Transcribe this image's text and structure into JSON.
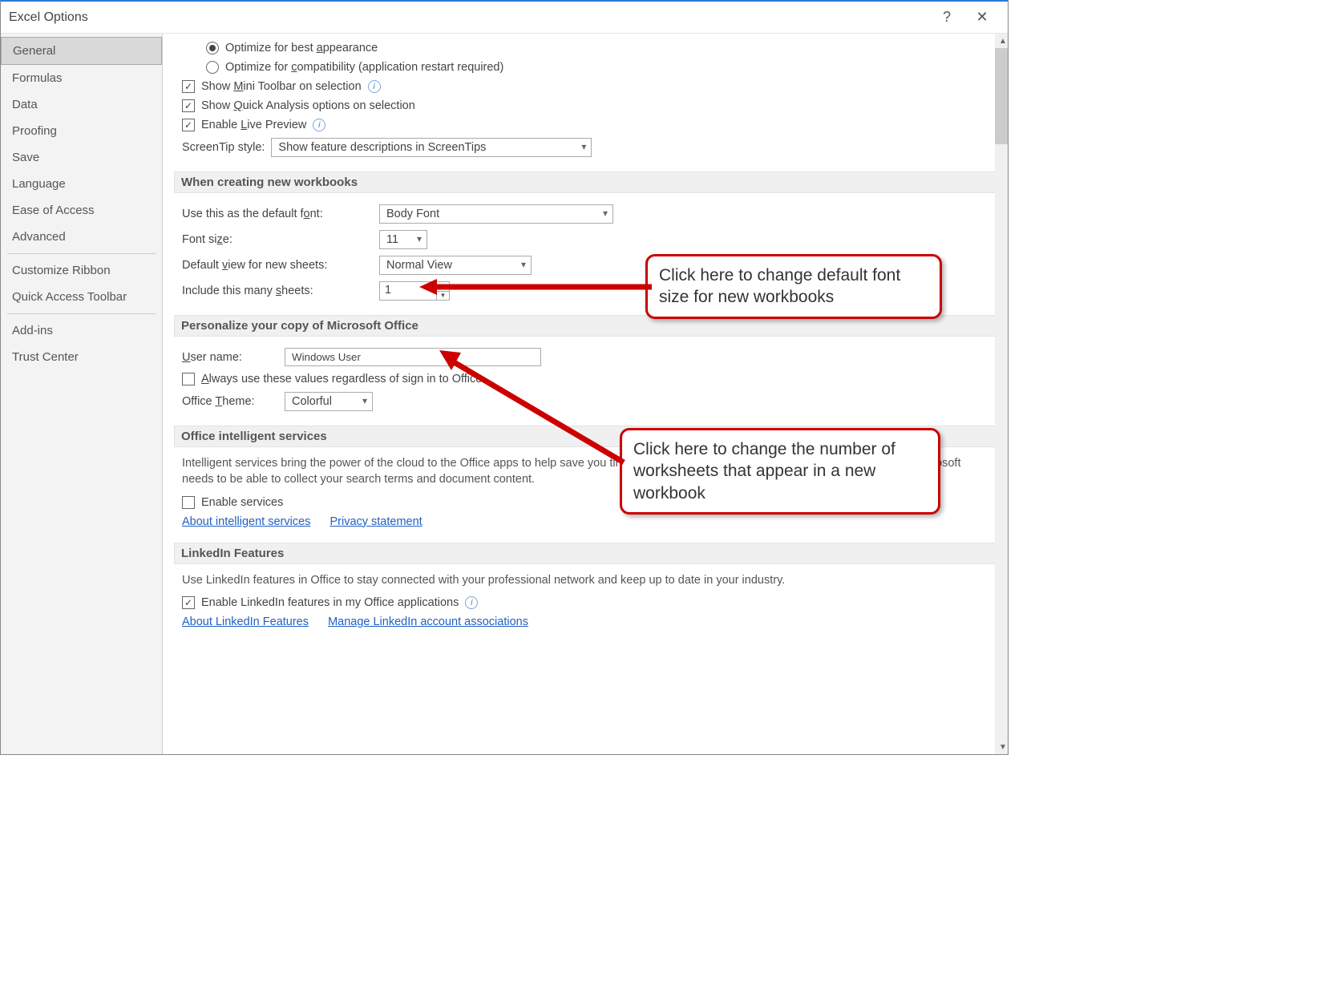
{
  "dialog": {
    "title": "Excel Options"
  },
  "sidebar": {
    "items": [
      "General",
      "Formulas",
      "Data",
      "Proofing",
      "Save",
      "Language",
      "Ease of Access",
      "Advanced",
      "Customize Ribbon",
      "Quick Access Toolbar",
      "Add-ins",
      "Trust Center"
    ],
    "selected": 0,
    "separators_after": [
      7,
      9
    ]
  },
  "ui": {
    "optimize_best": "Optimize for best appearance",
    "optimize_compat": "Optimize for compatibility (application restart required)",
    "show_mini_toolbar": "Show Mini Toolbar on selection",
    "show_quick_analysis": "Show Quick Analysis options on selection",
    "enable_live_preview": "Enable Live Preview",
    "screentip_label": "ScreenTip style:",
    "screentip_value": "Show feature descriptions in ScreenTips",
    "section_creating": "When creating new workbooks",
    "default_font_label": "Use this as the default font:",
    "default_font_value": "Body Font",
    "font_size_label": "Font size:",
    "font_size_value": "11",
    "default_view_label": "Default view for new sheets:",
    "default_view_value": "Normal View",
    "include_sheets_label": "Include this many sheets:",
    "include_sheets_value": "1",
    "section_personalize": "Personalize your copy of Microsoft Office",
    "username_label": "User name:",
    "username_value": "Windows User",
    "always_use_values": "Always use these values regardless of sign in to Office.",
    "office_theme_label": "Office Theme:",
    "office_theme_value": "Colorful",
    "section_intelligent": "Office intelligent services",
    "intelligent_desc": "Intelligent services bring the power of the cloud to the Office apps to help save you time and produce better results. To provide these services, Microsoft needs to be able to collect your search terms and document content.",
    "enable_services": "Enable services",
    "link_about_intelligent": "About intelligent services",
    "link_privacy": "Privacy statement",
    "section_linkedin": "LinkedIn Features",
    "linkedin_desc": "Use LinkedIn features in Office to stay connected with your professional network and keep up to date in your industry.",
    "enable_linkedin": "Enable LinkedIn features in my Office applications",
    "link_about_linkedin": "About LinkedIn Features",
    "link_manage_linkedin": "Manage LinkedIn account associations"
  },
  "callouts": {
    "font_size": "Click here to change default font size for new workbooks",
    "sheets": "Click here to change the number of worksheets that appear in a new workbook"
  }
}
